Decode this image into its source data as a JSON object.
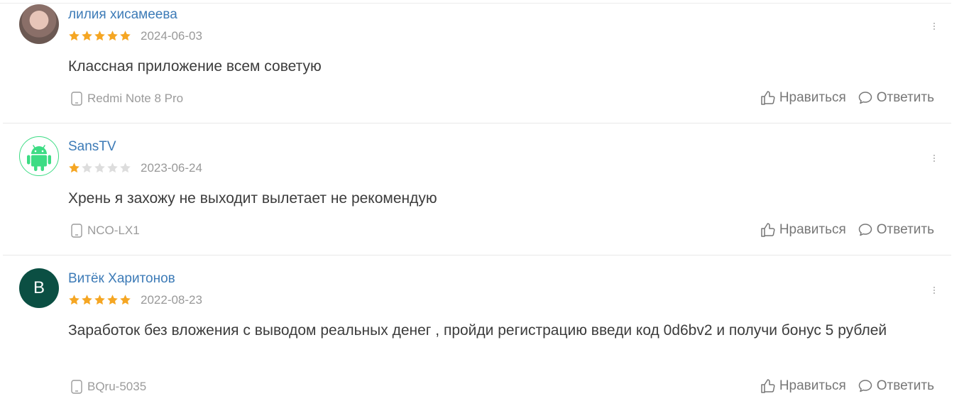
{
  "reviews": [
    {
      "name": "лилия хисамеева",
      "avatar": "photo",
      "rating": 5,
      "date": "2024-06-03",
      "text": "Классная приложение всем советую",
      "device": "Redmi Note 8 Pro",
      "like_label": "Нравиться",
      "reply_label": "Ответить"
    },
    {
      "name": "SansTV",
      "avatar": "android-icon",
      "rating": 1,
      "date": "2023-06-24",
      "text": "Хрень я захожу не выходит вылетает не рекомендую",
      "device": "NCO-LX1",
      "like_label": "Нравиться",
      "reply_label": "Ответить"
    },
    {
      "name": "Витёк Харитонов",
      "avatar_letter": "В",
      "rating": 5,
      "date": "2022-08-23",
      "text": "Заработок без вложения с выводом реальных денег , пройди регистрацию введи код 0d6bv2 и получи бонус 5 рублей",
      "device": "BQru-5035",
      "like_label": "Нравиться",
      "reply_label": "Ответить"
    }
  ],
  "colors": {
    "star_filled": "#f5a623",
    "star_empty": "#dddddd",
    "name": "#3d7bb7",
    "android_green": "#3ddc84",
    "avatar_letter_bg": "#0b4f43"
  },
  "icons": {
    "more": "more-vertical-icon",
    "device": "phone-icon",
    "like": "thumbs-up-icon",
    "reply": "comment-icon"
  }
}
